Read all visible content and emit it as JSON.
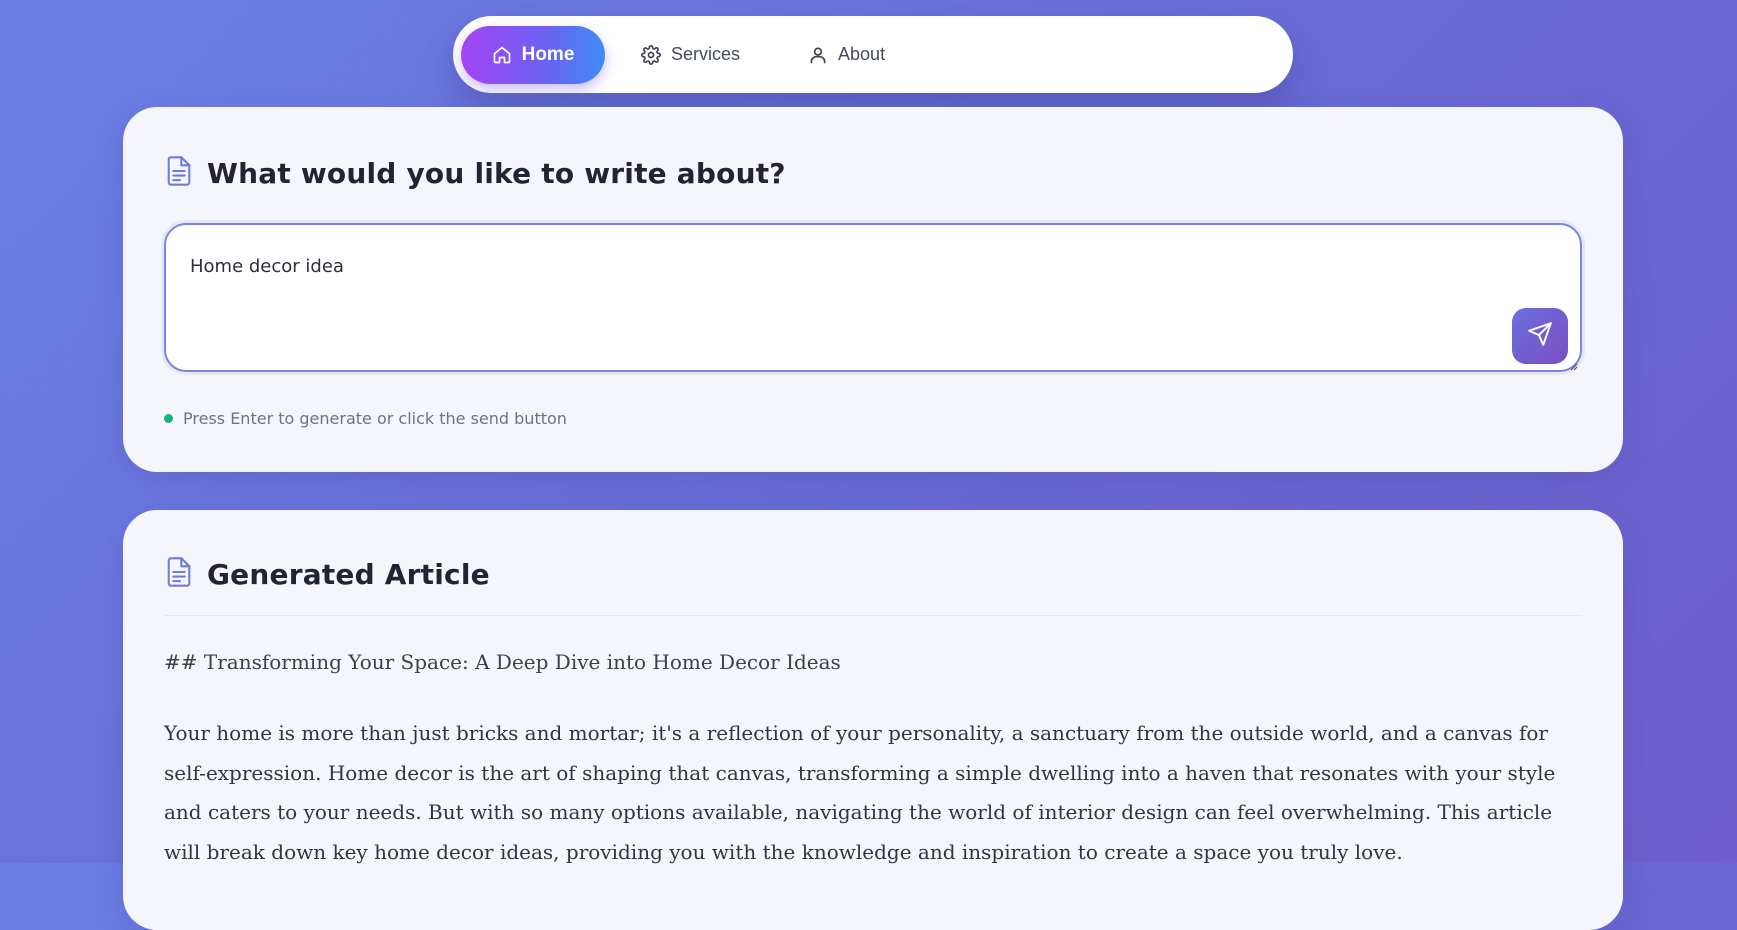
{
  "nav": {
    "items": [
      {
        "label": "Home",
        "icon": "home-icon",
        "active": true
      },
      {
        "label": "Services",
        "icon": "gear-icon",
        "active": false
      },
      {
        "label": "About",
        "icon": "user-icon",
        "active": false
      }
    ]
  },
  "prompt_card": {
    "title": "What would you like to write about?",
    "icon": "document-icon",
    "input_value": "Home decor idea",
    "send_icon": "send-icon",
    "hint": "Press Enter to generate or click the send button",
    "hint_color": "#19b37a"
  },
  "article_card": {
    "title": "Generated Article",
    "icon": "document-icon",
    "heading": "## Transforming Your Space: A Deep Dive into Home Decor Ideas",
    "paragraph": "Your home is more than just bricks and mortar; it's a reflection of your personality, a sanctuary from the outside world, and a canvas for self-expression. Home decor is the art of shaping that canvas, transforming a simple dwelling into a haven that resonates with your style and caters to your needs. But with so many options available, navigating the world of interior design can feel overwhelming. This article will break down key home decor ideas, providing you with the knowledge and inspiration to create a space you truly love."
  },
  "colors": {
    "accent_start": "#a544f5",
    "accent_end": "#3f8cf6",
    "background": "#6b7fe6"
  }
}
